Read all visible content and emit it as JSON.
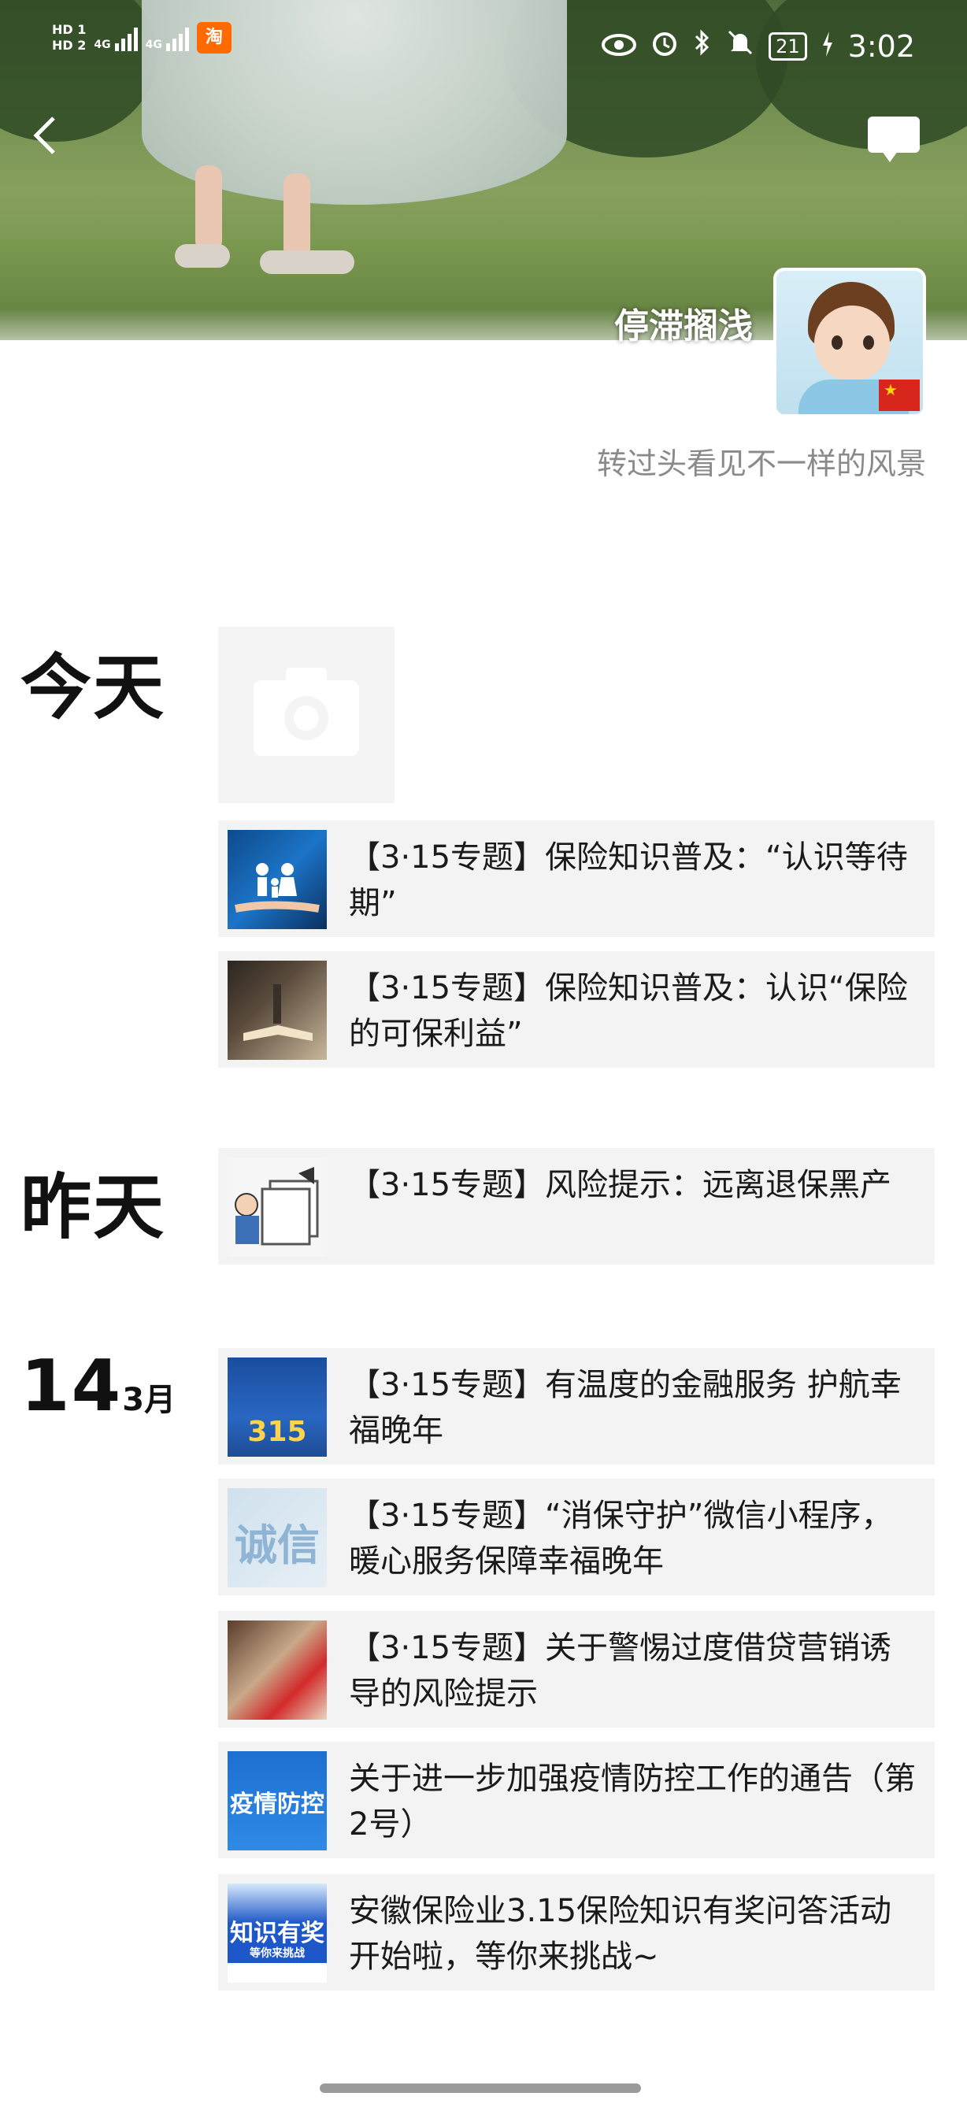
{
  "status_bar": {
    "hd1": "HD 1",
    "hd2": "HD 2",
    "net1": "4G",
    "net2": "4G",
    "taobao": "淘",
    "battery": "21",
    "time": "3:02"
  },
  "profile": {
    "username": "停滞搁浅",
    "signature": "转过头看见不一样的风景"
  },
  "timeline": {
    "today": "今天",
    "yesterday": "昨天",
    "date_day": "14",
    "date_month": "3月"
  },
  "posts": [
    {
      "title": "【3·15专题】保险知识普及：“认识等待期”"
    },
    {
      "title": "【3·15专题】保险知识普及：认识“保险的可保利益”"
    },
    {
      "title": "【3·15专题】风险提示：远离退保黑产"
    },
    {
      "title": "【3·15专题】有温度的金融服务 护航幸福晚年",
      "thumb_text": "315"
    },
    {
      "title": "【3·15专题】“消保守护”微信小程序，暖心服务保障幸福晚年",
      "thumb_text": "诚信"
    },
    {
      "title": "【3·15专题】关于警惕过度借贷营销诱导的风险提示"
    },
    {
      "title": "关于进一步加强疫情防控工作的通告（第2号）",
      "thumb_text": "疫情防控"
    },
    {
      "title": "安徽保险业3.15保险知识有奖问答活动开始啦，等你来挑战~",
      "thumb_text": "知识有奖",
      "thumb_subtext": "等你来挑战"
    }
  ],
  "colors": {
    "post_bg": "#f3f3f3",
    "signature_text": "#8a8a8a"
  },
  "icons": [
    "back-arrow-icon",
    "comment-icon",
    "camera-icon",
    "eye-icon",
    "alarm-icon",
    "bluetooth-icon",
    "mute-icon",
    "charging-icon"
  ]
}
